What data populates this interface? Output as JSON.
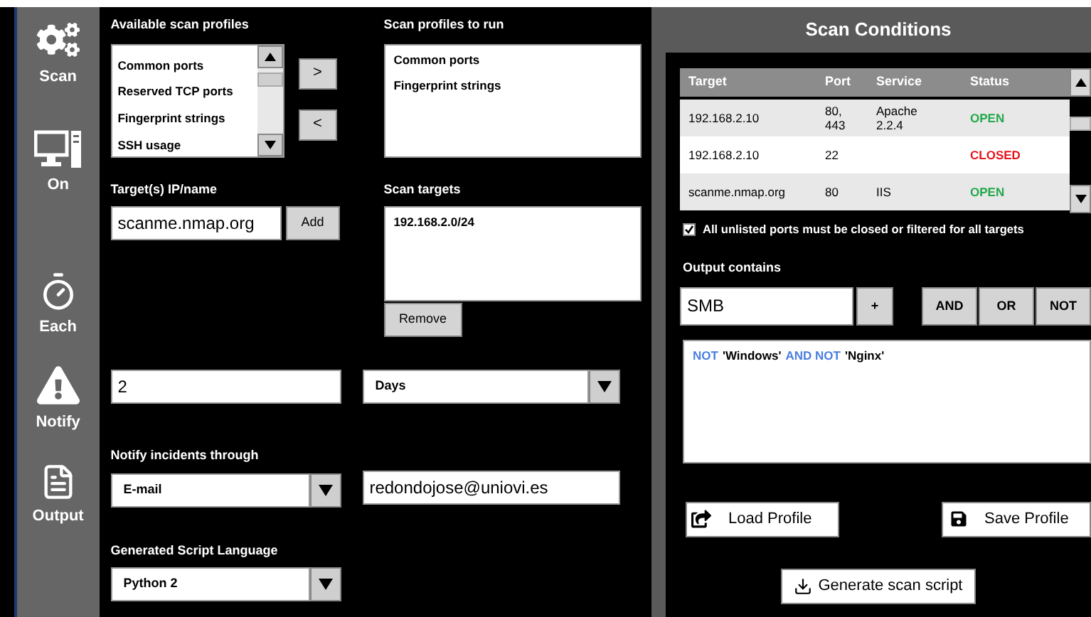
{
  "sidebar": {
    "items": [
      {
        "label": "Scan",
        "kind": "gears"
      },
      {
        "label": "On",
        "kind": "computer"
      },
      {
        "label": "Each",
        "kind": "stopwatch"
      },
      {
        "label": "Notify",
        "kind": "warning"
      },
      {
        "label": "Output",
        "kind": "document"
      }
    ]
  },
  "available_profiles": {
    "label": "Available scan profiles",
    "items": [
      "Common ports",
      "Reserved TCP ports",
      "Fingerprint strings",
      "SSH usage"
    ]
  },
  "move_buttons": [
    ">",
    "<"
  ],
  "profiles_to_run": {
    "label": "Scan profiles to run",
    "items": [
      "Common ports",
      "Fingerprint strings"
    ]
  },
  "target_input": {
    "label": "Target(s) IP/name",
    "value": "scanme.nmap.org",
    "button": "Add"
  },
  "scan_targets": {
    "label": "Scan targets",
    "items": [
      "192.168.2.0/24"
    ],
    "button": "Remove"
  },
  "interval": {
    "value": "2",
    "unit": "Days"
  },
  "notify": {
    "label": "Notify incidents through",
    "method": "E-mail",
    "address": "redondojose@uniovi.es"
  },
  "script_language": {
    "label": "Generated Script Language",
    "value": "Python 2"
  },
  "scan_conditions": {
    "title": "Scan Conditions",
    "table": {
      "columns": [
        "Target",
        "Port",
        "Service",
        "Status"
      ],
      "rows": [
        {
          "target": "192.168.2.10",
          "port": "80, 443",
          "service": "Apache 2.2.4",
          "status": "OPEN",
          "kind": "open"
        },
        {
          "target": "192.168.2.10",
          "port": "22",
          "service": "",
          "status": "CLOSED",
          "kind": "closed"
        },
        {
          "target": "scanme.nmap.org",
          "port": "80",
          "service": "IIS",
          "status": "OPEN",
          "kind": "open"
        }
      ]
    },
    "unlisted_ports": {
      "label": "All unlisted ports must be closed or filtered for all targets",
      "checked": true
    },
    "output_contains": {
      "label": "Output contains",
      "value": "SMB",
      "add_button": "+",
      "operators": [
        "AND",
        "OR",
        "NOT"
      ]
    },
    "expression": [
      {
        "text": "NOT",
        "kind": "keyword"
      },
      {
        "text": "'Windows'",
        "kind": "literal"
      },
      {
        "text": "AND NOT",
        "kind": "keyword"
      },
      {
        "text": "'Nginx'",
        "kind": "literal"
      }
    ],
    "load_button": "Load Profile",
    "save_button": "Save Profile",
    "generate_button": "Generate scan script"
  }
}
